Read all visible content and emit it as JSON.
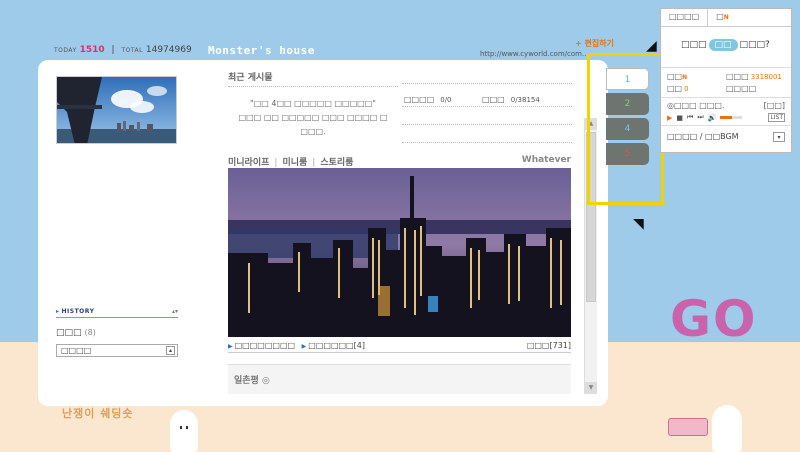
{
  "header": {
    "today_label": "TODAY",
    "today_count": "1510",
    "separator": "|",
    "total_label": "TOTAL",
    "total_count": "14974969",
    "home_title": "Monster's house",
    "edit_link": "+ 편집하기",
    "url": "http://www.cyworld.com/com..."
  },
  "left_panel": {
    "history_title": "HISTORY",
    "history_toggle": "▴▾",
    "history_item": "□□□",
    "history_count": "(8)",
    "history_select": "□□□□",
    "history_select_btn": "▴"
  },
  "recent": {
    "title": "최근 게시물",
    "message_line1": "\"□□ 4□□ □□□□□ □□□□□\"",
    "message_line2": "□□□ □□ □□□□□ □□□ □□□□ □",
    "message_line3": "□□□.",
    "stat1_label": "□□□□",
    "stat1_value": "0/0",
    "stat2_label": "□□□",
    "stat2_value": "0/38154"
  },
  "media": {
    "tab1": "미니라이프",
    "tab2": "미니룸",
    "tab3": "스토리룸",
    "pipe": "|",
    "right_label": "Whatever",
    "foot_left1": "□□□□□□□□",
    "foot_left2": "□□□□□□[4]",
    "foot_right": "□□□[731]"
  },
  "guestbook": {
    "label": "일촌평 ◎"
  },
  "nav_tabs": [
    "1",
    "2",
    "4",
    "5"
  ],
  "widget": {
    "tab_active": "□□□□",
    "tab_other": "□",
    "tab_new": "N",
    "question_pre": "□□□",
    "question_pill": "□□",
    "question_post": "□□□?",
    "stat_a_label": "□□",
    "stat_a_new": "N",
    "stat_b_label": "□□□",
    "stat_b_value": "3318001",
    "stat_c_label": "□□",
    "stat_c_value": "0",
    "stat_d_label": "□□□□",
    "track": "◎□□□ □□□.",
    "track_btn": "[□□]",
    "list_btn": "LIST",
    "bgm_label": "□□□□ / □□BGM",
    "bgm_dd": "▾"
  },
  "decor": {
    "go": "GO",
    "footer": "난쟁이 쉐딩숏"
  },
  "colors": {
    "sky": "#9ecbea",
    "sand": "#fbe7cf",
    "highlight": "#f2d300",
    "go": "#c963ae",
    "accent_orange": "#e8740c",
    "tab_dark": "#6e7470"
  },
  "volume_level": 0.55
}
